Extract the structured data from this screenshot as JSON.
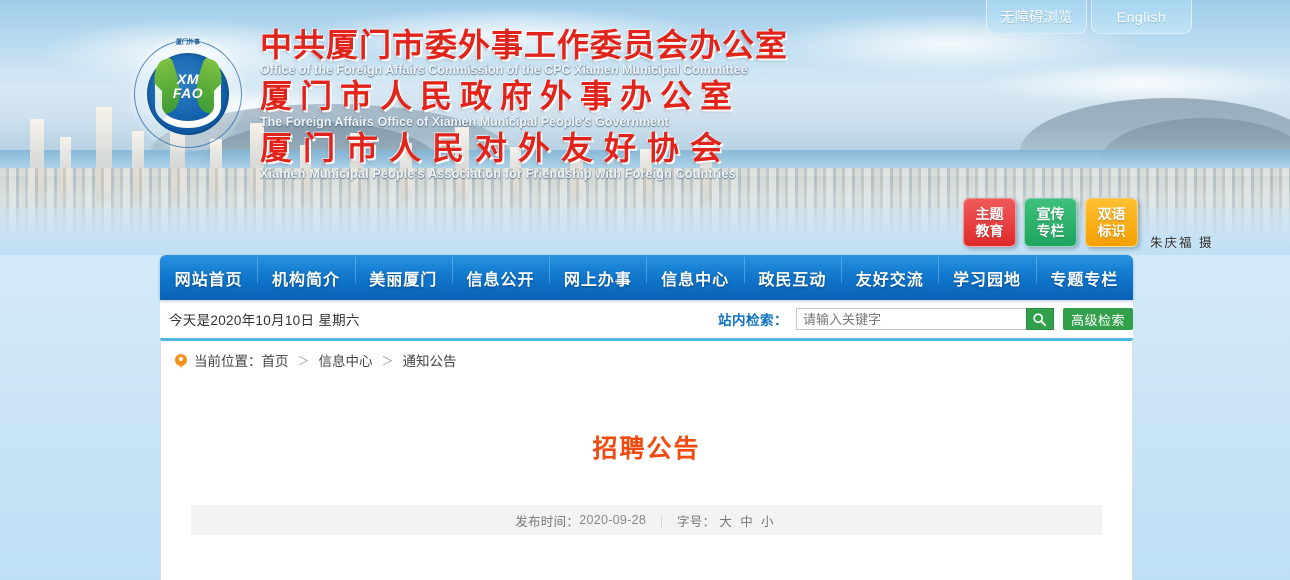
{
  "top_buttons": [
    {
      "label": "无障碍浏览",
      "name": "accessibility-browse-button"
    },
    {
      "label": "English",
      "name": "english-language-button"
    }
  ],
  "masthead": {
    "logo": {
      "abbr_line1": "XM",
      "abbr_line2": "FAO",
      "curve_top": "厦门外事",
      "curve_bottom": "Foreign Affairs Office of Xiamen Municipal People's Government"
    },
    "lines": [
      {
        "cn": "中共厦门市委外事工作委员会办公室",
        "en": "Office of the Foreign  Affairs Commission of the CPC Xiamen Municipal Committee"
      },
      {
        "cn": "厦门市人民政府外事办公室",
        "en": "The Foreign Affairs Office of Xiamen  Municipal People's Government"
      },
      {
        "cn": "厦门市人民对外友好协会",
        "en": "Xiamen Municipal People's Association for Friendship with Foreign Countries"
      }
    ]
  },
  "quick_buttons": [
    {
      "line1": "主题",
      "line2": "教育",
      "color": "#e02a2a",
      "name": "quick-button-theme-education"
    },
    {
      "line1": "宣传",
      "line2": "专栏",
      "color": "#1da55f",
      "name": "quick-button-publicity-column"
    },
    {
      "line1": "双语",
      "line2": "标识",
      "color": "#f5a000",
      "name": "quick-button-bilingual-signage"
    }
  ],
  "photo_credit": "朱庆福 摄",
  "nav": {
    "items": [
      "网站首页",
      "机构简介",
      "美丽厦门",
      "信息公开",
      "网上办事",
      "信息中心",
      "政民互动",
      "友好交流",
      "学习园地",
      "专题专栏"
    ]
  },
  "subbar": {
    "date_text": "今天是2020年10月10日  星期六",
    "search_label": "站内检索：",
    "search_placeholder": "请输入关键字",
    "search_value": "",
    "search_icon": "search-icon",
    "advanced_search_label": "高级检索"
  },
  "breadcrumb": {
    "prefix": "当前位置：",
    "pin_icon": "location-pin-icon",
    "items": [
      "首页",
      "信息中心",
      "通知公告"
    ],
    "separator": "＞"
  },
  "article": {
    "title": "招聘公告",
    "publish_label": "发布时间：",
    "publish_date": "2020-09-28",
    "meta_separator": "｜",
    "fontsize_label": "字号：",
    "fontsize_options": [
      "大",
      "中",
      "小"
    ]
  },
  "colors": {
    "accent_blue": "#0f76cc",
    "panel_border_blue": "#4db8e8",
    "title_red": "#e2231a",
    "article_title": "#f04a0f",
    "search_green": "#32a04a",
    "pin_orange": "#f5921e"
  }
}
